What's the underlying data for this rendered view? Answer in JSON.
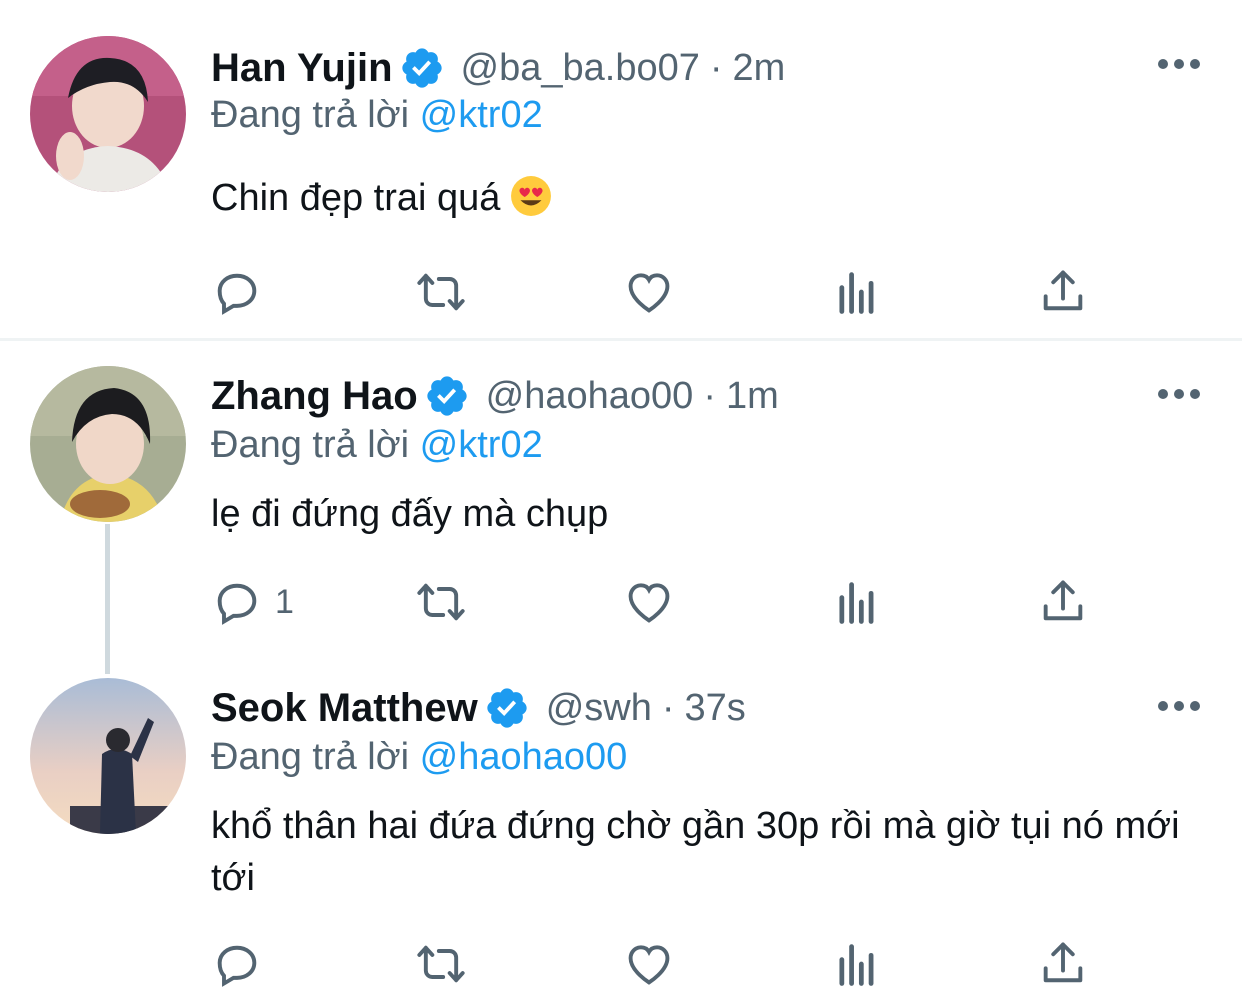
{
  "colors": {
    "accent": "#1d9bf0",
    "secondary": "#536471",
    "divider": "#eff3f4"
  },
  "tweets": [
    {
      "name": "Han Yujin",
      "handle": "@ba_ba.bo07",
      "separator": "·",
      "time": "2m",
      "reply_prefix": "Đang trả lời",
      "reply_to": "@ktr02",
      "text": "Chin đẹp trai quá",
      "emoji": "smiling-face-heart-eyes",
      "reply_count": ""
    },
    {
      "name": "Zhang Hao",
      "handle": "@haohao00",
      "separator": "·",
      "time": "1m",
      "reply_prefix": "Đang trả lời",
      "reply_to": "@ktr02",
      "text": "lẹ đi đứng đấy mà chụp",
      "reply_count": "1"
    },
    {
      "name": "Seok Matthew",
      "handle": "@swh",
      "separator": "·",
      "time": "37s",
      "reply_prefix": "Đang trả lời",
      "reply_to": "@haohao00",
      "text": "khổ thân hai đứa đứng chờ gần 30p rồi mà giờ tụi nó mới tới",
      "reply_count": ""
    }
  ],
  "icons": [
    "reply-icon",
    "retweet-icon",
    "like-icon",
    "views-icon",
    "share-icon",
    "more-icon",
    "verified-badge-icon"
  ]
}
